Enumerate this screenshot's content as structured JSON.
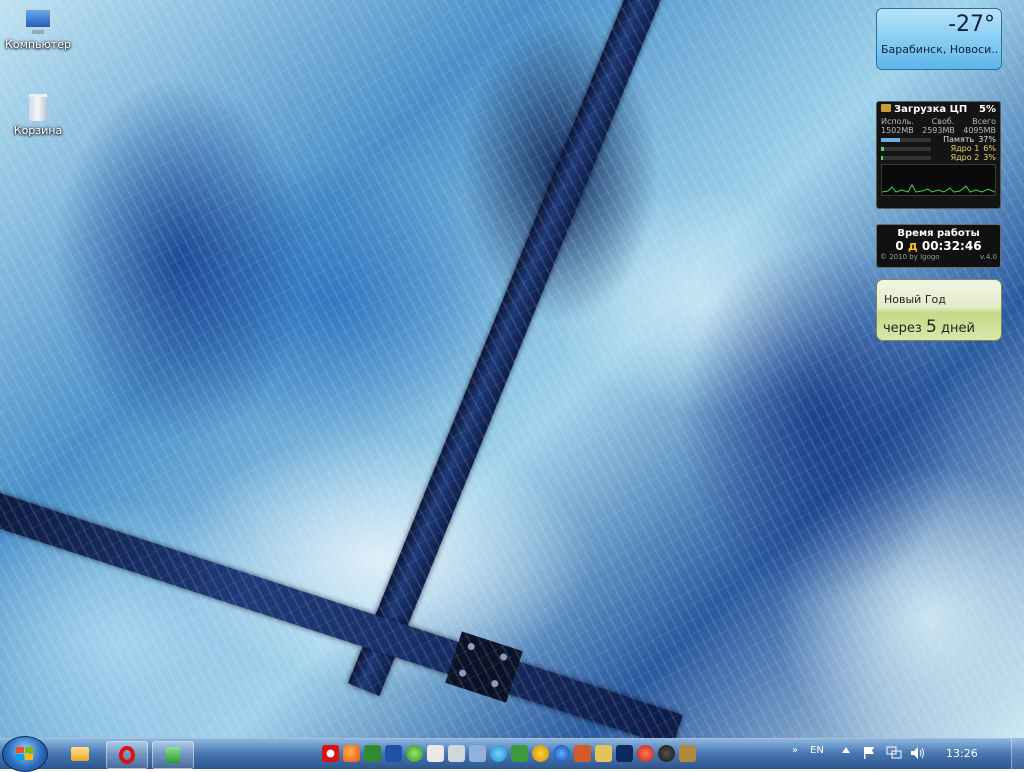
{
  "desktop": {
    "icons": [
      {
        "label": "Компьютер",
        "icon": "computer-icon"
      },
      {
        "label": "Корзина",
        "icon": "recycle-bin-icon"
      }
    ]
  },
  "gadgets": {
    "weather": {
      "temperature": "-27°",
      "city": "Барабинск, Новоси..."
    },
    "cpu": {
      "title": "Загрузка ЦП",
      "percent": "5%",
      "mem_headers": [
        "Исполь.",
        "Своб.",
        "Всего"
      ],
      "mem_values": [
        "1502MB",
        "2593MB",
        "4095MB"
      ],
      "rows": [
        {
          "name": "Память",
          "value": "37%",
          "level": 0.37
        },
        {
          "name": "Ядро 1",
          "value": "6%",
          "level": 0.06
        },
        {
          "name": "Ядро 2",
          "value": "3%",
          "level": 0.03
        }
      ]
    },
    "uptime": {
      "title": "Время работы",
      "days": "0",
      "days_unit": "д",
      "time": "00:32:46",
      "copyright": "© 2010 by Igogo",
      "version": "v.4.0"
    },
    "new_year": {
      "title": "Новый Год",
      "prefix": "через",
      "number": "5",
      "suffix": "дней"
    }
  },
  "taskbar": {
    "start_icon": "windows-logo-icon",
    "pinned": [
      {
        "name": "explorer-icon",
        "pressed": false
      },
      {
        "name": "opera-icon",
        "pressed": true
      },
      {
        "name": "gadget-app-icon",
        "pressed": true
      }
    ],
    "quick_launch_icons": [
      "opera-icon",
      "firefox-icon",
      "notepadplusplus-icon",
      "save-icon",
      "media-player-icon",
      "gmail-icon",
      "network-icon",
      "photo-icon",
      "skype-icon",
      "puzzle-icon",
      "aimp-icon",
      "storm-icon",
      "gallery-icon",
      "folder-icon",
      "photoshop-icon",
      "red-app-icon",
      "steam-icon",
      "archive-icon"
    ],
    "overflow_chevron": "»",
    "language": "EN",
    "tray_icons": [
      "show-hidden-icon",
      "flag-icon",
      "network-tray-icon",
      "volume-icon"
    ],
    "clock": "13:26"
  },
  "colors": {
    "taskbar": "#3c6ea8",
    "weather_bg": "#5db6ea",
    "newyear_bg": "#d9e7aa",
    "cpu_bg": "#141414"
  }
}
